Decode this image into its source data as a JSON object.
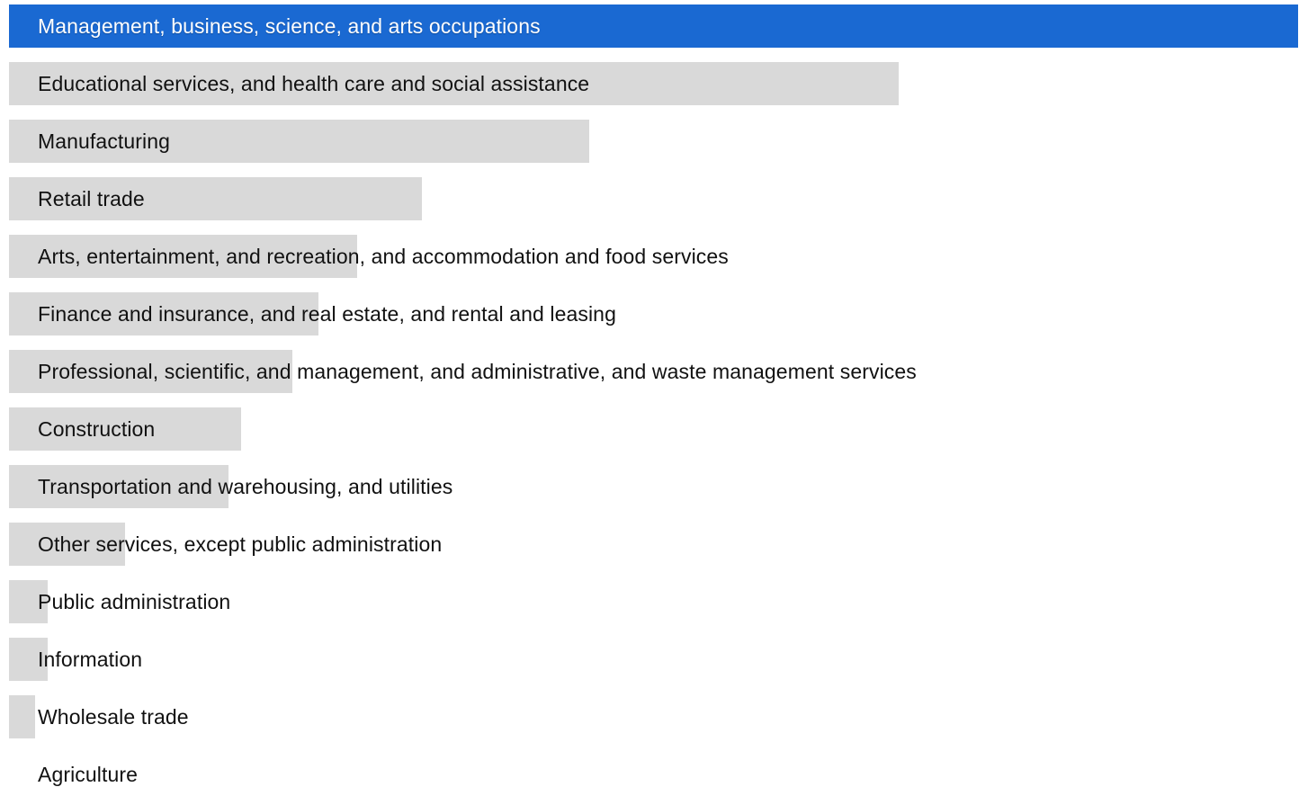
{
  "colors": {
    "highlight": "#1a69d2",
    "bar": "#d9d9d9",
    "text": "#111111",
    "highlight_text": "#ffffff"
  },
  "chart_data": {
    "type": "bar",
    "orientation": "horizontal",
    "categories": [
      "Management, business, science, and arts occupations",
      "Educational services, and health care and social assistance",
      "Manufacturing",
      "Retail trade",
      "Arts, entertainment, and recreation, and accommodation and food services",
      "Finance and insurance, and real estate, and rental and leasing",
      "Professional, scientific, and management, and administrative, and waste management services",
      "Construction",
      "Transportation and warehousing, and utilities",
      "Other services, except public administration",
      "Public administration",
      "Information",
      "Wholesale trade",
      "Agriculture"
    ],
    "values": [
      100,
      69,
      45,
      32,
      27,
      24,
      22,
      18,
      17,
      9,
      3,
      3,
      2,
      0
    ],
    "value_unit": "percent of largest category",
    "highlighted_index": 0,
    "xlim": [
      0,
      100
    ],
    "grid": false,
    "legend": "none"
  }
}
